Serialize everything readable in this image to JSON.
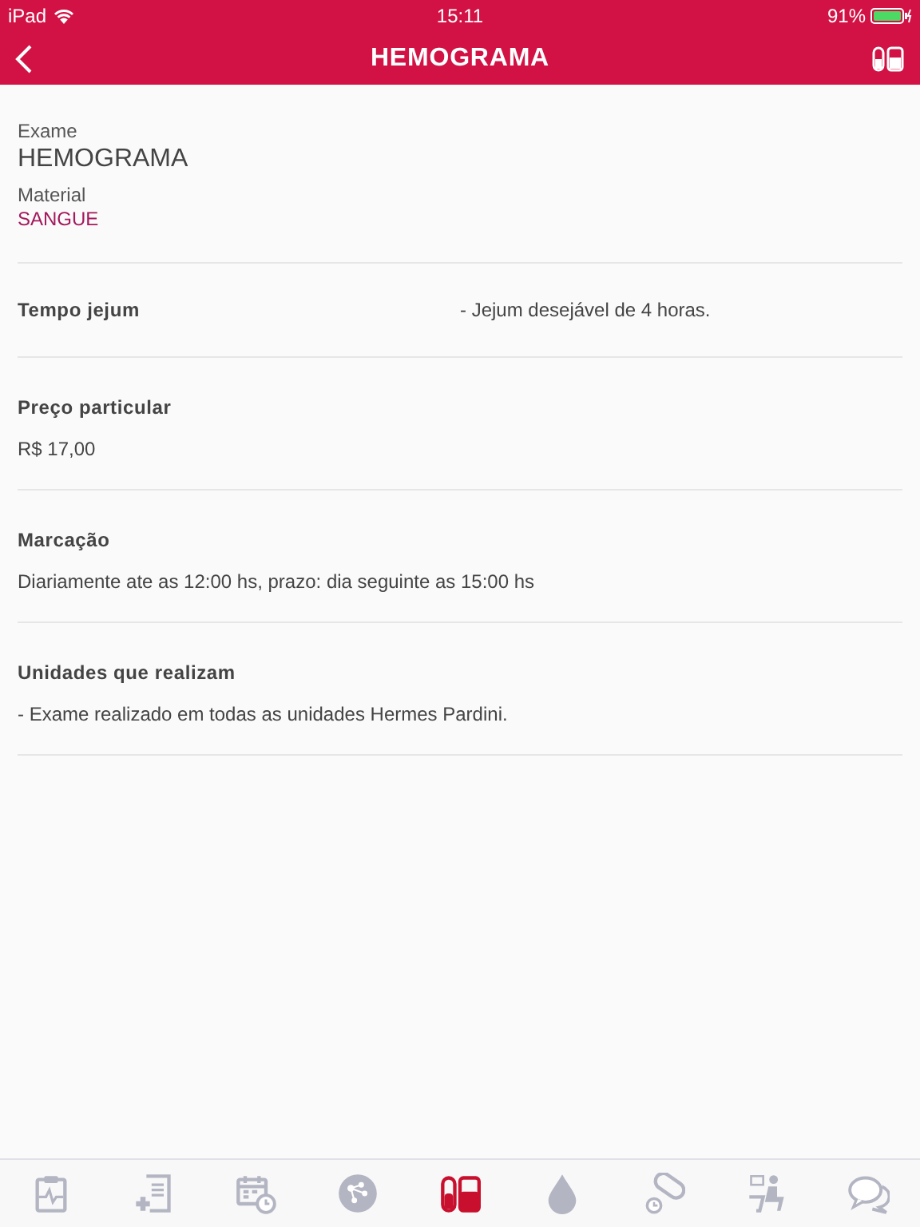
{
  "status_bar": {
    "device": "iPad",
    "time": "15:11",
    "battery": "91%"
  },
  "nav": {
    "title": "HEMOGRAMA"
  },
  "header": {
    "exam_label": "Exame",
    "exam": "HEMOGRAMA",
    "material_label": "Material",
    "material": "SANGUE"
  },
  "sections": [
    {
      "kind": "inline",
      "label": "Tempo jejum",
      "value": "- Jejum desejável de 4 horas."
    },
    {
      "kind": "stacked",
      "label": "Preço particular",
      "value": "R$ 17,00"
    },
    {
      "kind": "stacked",
      "label": "Marcação",
      "value": "Diariamente ate as 12:00 hs, prazo: dia seguinte as 15:00 hs"
    },
    {
      "kind": "stacked",
      "label": "Unidades que realizam",
      "value": "- Exame realizado em todas as unidades Hermes Pardini."
    }
  ],
  "tab_bar": [
    {
      "selected": false
    },
    {
      "selected": false
    },
    {
      "selected": false
    },
    {
      "selected": false
    },
    {
      "selected": true
    },
    {
      "selected": false
    },
    {
      "selected": false
    },
    {
      "selected": false
    },
    {
      "selected": false
    }
  ]
}
